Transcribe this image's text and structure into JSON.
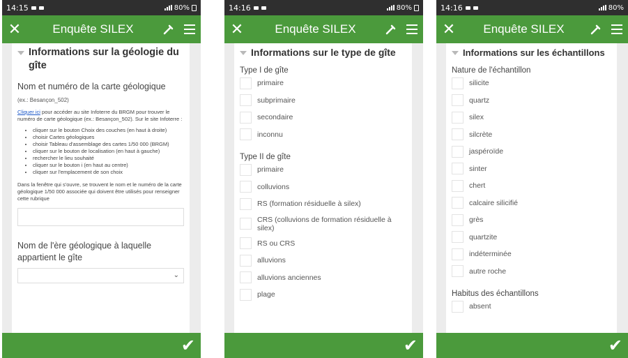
{
  "app": {
    "title": "Enquête SILEX"
  },
  "screen1": {
    "status_time": "14:15",
    "status_right": "80%",
    "section_title": "Informations sur la géologie du gîte",
    "field1_label": "Nom et numéro de la carte géologique",
    "field1_hint": "(ex.: Besançon_502)",
    "link_text": "Cliquer ici",
    "paragraph1": " pour accéder au site Infoterre du BRGM pour trouver le numéro de carte géologique (ex.: Besançon_502). Sur le site Infoterre :",
    "bullets": [
      "cliquer sur le bouton Choix des couches (en haut à droite)",
      "choisir Cartes géologiques",
      "choisir Tableau d'assemblage des cartes 1/50 000 (BRGM)",
      "cliquer sur le bouton de localisation (en haut à gauche)",
      "rechercher le lieu souhaité",
      "cliquer sur le bouton i (en haut au centre)",
      "cliquer sur l'emplacement de son choix"
    ],
    "paragraph2": "Dans la fenêtre qui s'ouvre, se trouvent le nom et le numéro de la carte géologique 1/50 000 associée qui doivent être utilisés pour renseigner cette rubrique",
    "field2_label": "Nom de l'ère géologique à laquelle appartient le gîte"
  },
  "screen2": {
    "status_time": "14:16",
    "status_right": "80%",
    "section_title": "Informations sur le type de gîte",
    "group1_label": "Type I de gîte",
    "group1_options": [
      "primaire",
      "subprimaire",
      "secondaire",
      "inconnu"
    ],
    "group2_label": "Type II de gîte",
    "group2_options": [
      "primaire",
      "colluvions",
      "RS (formation résiduelle à silex)",
      "CRS (colluvions de formation résiduelle à silex)",
      "RS ou CRS",
      "alluvions",
      "alluvions anciennes",
      "plage"
    ]
  },
  "screen3": {
    "status_time": "14:16",
    "status_right": "80%",
    "section_title": "Informations sur les échantillons",
    "group1_label": "Nature de l'échantillon",
    "group1_options": [
      "silicite",
      "quartz",
      "silex",
      "silcrète",
      "jaspéroïde",
      "sinter",
      "chert",
      "calcaire silicifié",
      "grès",
      "quartzite",
      "indéterminée",
      "autre roche"
    ],
    "group2_label": "Habitus des échantillons",
    "group2_options": [
      "absent"
    ]
  },
  "colors": {
    "appbar": "#4b9a3c",
    "statusbar": "#2f2f2f",
    "background": "#ececec"
  },
  "icons": {
    "close": "close-icon",
    "tool": "pen-tool-icon",
    "menu": "hamburger-menu-icon",
    "submit": "checkmark-icon"
  }
}
